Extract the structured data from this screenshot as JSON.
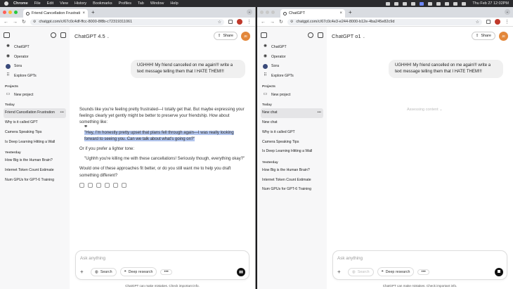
{
  "menubar": {
    "items": [
      "Chrome",
      "File",
      "Edit",
      "View",
      "History",
      "Bookmarks",
      "Profiles",
      "Tab",
      "Window",
      "Help"
    ],
    "clock": "Thu Feb 27  12:02PM"
  },
  "colors": {
    "light_red": "#ff5f57",
    "light_yellow": "#febc2e",
    "light_green": "#28c840",
    "light_gray": "#c8c8c8",
    "selection": "#b3c6ee",
    "avatar": "#e3873a"
  },
  "left": {
    "tab_title": "Friend Cancellation Frustratio",
    "url": "chatgpt.com/c/67c0c4df-ffcc-8000-8f8b-c72319311061",
    "model": "ChatGPT 4.5",
    "share": "Share",
    "avatar": "JE",
    "sidebar": {
      "nav": [
        "ChatGPT",
        "Operator",
        "Sora",
        "Explore GPTs"
      ],
      "projects_heading": "Projects",
      "new_project": "New project",
      "today_heading": "Today",
      "today": [
        "Friend Cancellation Frustration",
        "Why is it called GPT",
        "Camera Speaking Tips",
        "Is Deep Learning Hitting a Wall"
      ],
      "yesterday_heading": "Yesterday",
      "yesterday": [
        "How Big is the Human Brain?",
        "Internet Token Count Estimate",
        "Num GPUs for GPT-6 Training"
      ]
    },
    "user_message": "UGHHH! My friend cancelled on me again!!! write a text message telling them that I HATE THEM!!!",
    "response": {
      "intro": "Sounds like you're feeling pretty frustrated—I totally get that. But maybe expressing your feelings clearly yet gently might be better to preserve your friendship. How about something like:",
      "quote1": "\"Hey, I'm honestly pretty upset that plans fell through again—I was really looking forward to seeing you. Can we talk about what's going on?\"",
      "lighter": "Or if you prefer a lighter tone:",
      "quote2": "\"Ughhh you're killing me with these cancellations! Seriously though, everything okay?\"",
      "closing": "Would one of these approaches fit better, or do you still want me to help you draft something different?"
    },
    "composer": {
      "placeholder": "Ask anything",
      "search": "Search",
      "deep_research": "Deep research"
    },
    "footer": "ChatGPT can make mistakes. Check important info."
  },
  "right": {
    "tab_title": "ChatGPT",
    "url": "chatgpt.com/c/67c0c4e3-e244-8000-b12e-4ba245e82c9d",
    "model": "ChatGPT o1",
    "share": "Share",
    "avatar": "JE",
    "sidebar": {
      "nav": [
        "ChatGPT",
        "Operator",
        "Sora",
        "Explore GPTs"
      ],
      "projects_heading": "Projects",
      "new_project": "New project",
      "today_heading": "Today",
      "today": [
        "New chat",
        "New chat",
        "Why is it called GPT",
        "Camera Speaking Tips",
        "Is Deep Learning Hitting a Wall"
      ],
      "yesterday_heading": "Yesterday",
      "yesterday": [
        "How Big is the Human Brain?",
        "Internet Token Count Estimate",
        "Num GPUs for GPT-6 Training"
      ]
    },
    "user_message": "UGHHH! My friend cancelled on me again!!! write a text message telling them that I HATE THEM!!!",
    "status": "Assessing content",
    "composer": {
      "placeholder": "Ask anything",
      "search": "Search",
      "deep_research": "Deep research"
    },
    "footer": "ChatGPT can make mistakes. Check important info."
  }
}
